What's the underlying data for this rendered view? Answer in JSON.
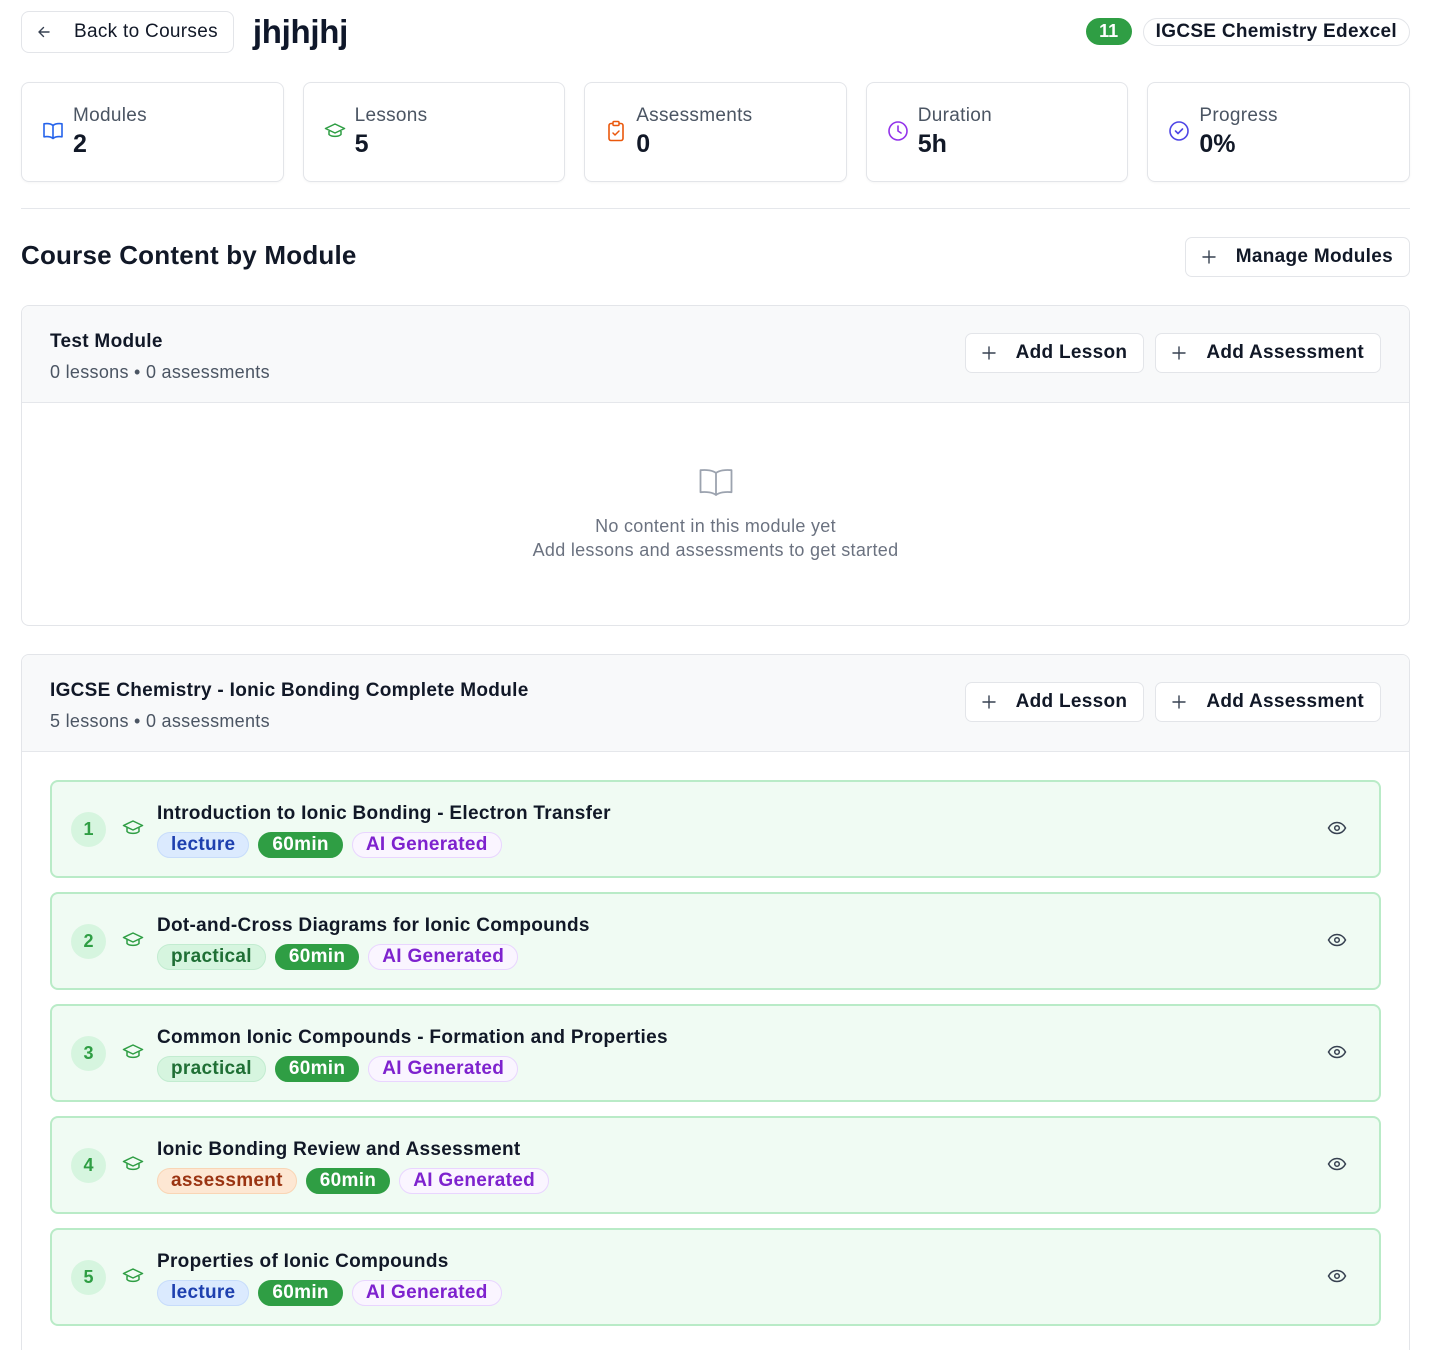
{
  "header": {
    "back_label": "Back to Courses",
    "course_title": "jhjhjhj",
    "count_badge": "11",
    "subject_badge": "IGCSE Chemistry Edexcel"
  },
  "stats": [
    {
      "label": "Modules",
      "value": "2",
      "icon": "book-open-icon",
      "color": "#2563eb"
    },
    {
      "label": "Lessons",
      "value": "5",
      "icon": "graduation-cap-icon",
      "color": "#2f9e44"
    },
    {
      "label": "Assessments",
      "value": "0",
      "icon": "clipboard-icon",
      "color": "#ea580c"
    },
    {
      "label": "Duration",
      "value": "5h",
      "icon": "clock-icon",
      "color": "#9333ea"
    },
    {
      "label": "Progress",
      "value": "0%",
      "icon": "check-circle-icon",
      "color": "#4f46e5"
    }
  ],
  "section": {
    "title": "Course Content by Module",
    "manage_label": "Manage Modules"
  },
  "modules": [
    {
      "name": "Test Module",
      "meta": "0 lessons • 0 assessments",
      "add_lesson_label": "Add Lesson",
      "add_assessment_label": "Add Assessment",
      "empty_title": "No content in this module yet",
      "empty_subtitle": "Add lessons and assessments to get started"
    },
    {
      "name": "IGCSE Chemistry - Ionic Bonding Complete Module",
      "meta": "5 lessons • 0 assessments",
      "add_lesson_label": "Add Lesson",
      "add_assessment_label": "Add Assessment",
      "lessons": [
        {
          "number": "1",
          "title": "Introduction to Ionic Bonding - Electron Transfer",
          "type": "lecture",
          "duration": "60min",
          "source": "AI Generated"
        },
        {
          "number": "2",
          "title": "Dot-and-Cross Diagrams for Ionic Compounds",
          "type": "practical",
          "duration": "60min",
          "source": "AI Generated"
        },
        {
          "number": "3",
          "title": "Common Ionic Compounds - Formation and Properties",
          "type": "practical",
          "duration": "60min",
          "source": "AI Generated"
        },
        {
          "number": "4",
          "title": "Ionic Bonding Review and Assessment",
          "type": "assessment",
          "duration": "60min",
          "source": "AI Generated"
        },
        {
          "number": "5",
          "title": "Properties of Ionic Compounds",
          "type": "lecture",
          "duration": "60min",
          "source": "AI Generated"
        }
      ]
    }
  ]
}
